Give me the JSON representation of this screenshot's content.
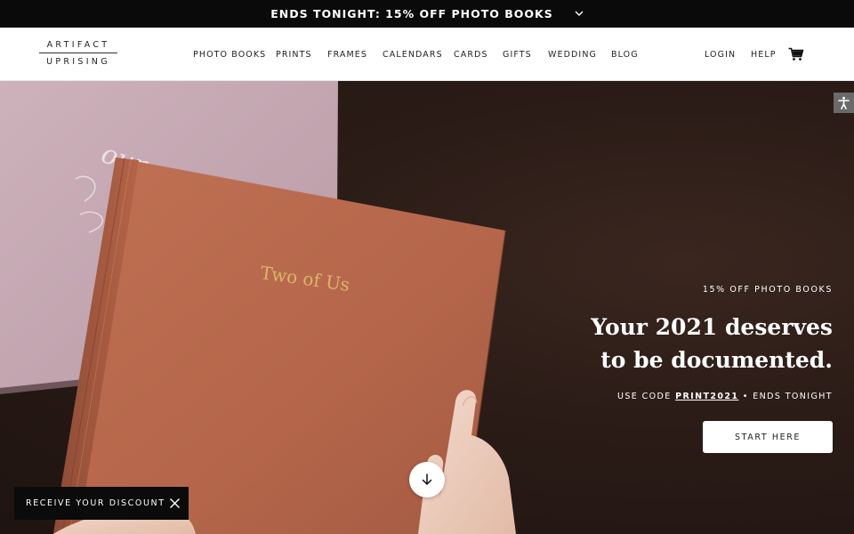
{
  "promo": {
    "text": "ENDS TONIGHT: 15% OFF PHOTO BOOKS",
    "toggle_icon": "chevron-down-icon"
  },
  "logo": {
    "line1": "ARTIFACT",
    "line2": "UPRISING"
  },
  "nav": {
    "items": [
      "PHOTO BOOKS",
      "PRINTS",
      "FRAMES",
      "CALENDARS",
      "CARDS",
      "GIFTS",
      "WEDDING",
      "BLOG"
    ],
    "login": "LOGIN",
    "help": "HELP",
    "cart_icon": "cart-icon"
  },
  "hero": {
    "eyebrow": "15% OFF PHOTO BOOKS",
    "headline_line1": "Your 2021 deserves",
    "headline_line2": "to be documented.",
    "code_prefix": "USE CODE ",
    "code": "PRINT2021",
    "code_suffix": " • ENDS TONIGHT",
    "cta": "START HERE",
    "book_title": "Two of Us",
    "script_text": "our",
    "scroll_icon": "arrow-down-icon",
    "accessibility_icon": "accessibility-icon"
  },
  "discount": {
    "label": "RECEIVE YOUR DISCOUNT",
    "close_icon": "close-icon"
  },
  "colors": {
    "book": "#b96a4f",
    "pink_book": "#c9aab4",
    "background": "#2a1b16",
    "gold_foil": "#d9b56a"
  }
}
